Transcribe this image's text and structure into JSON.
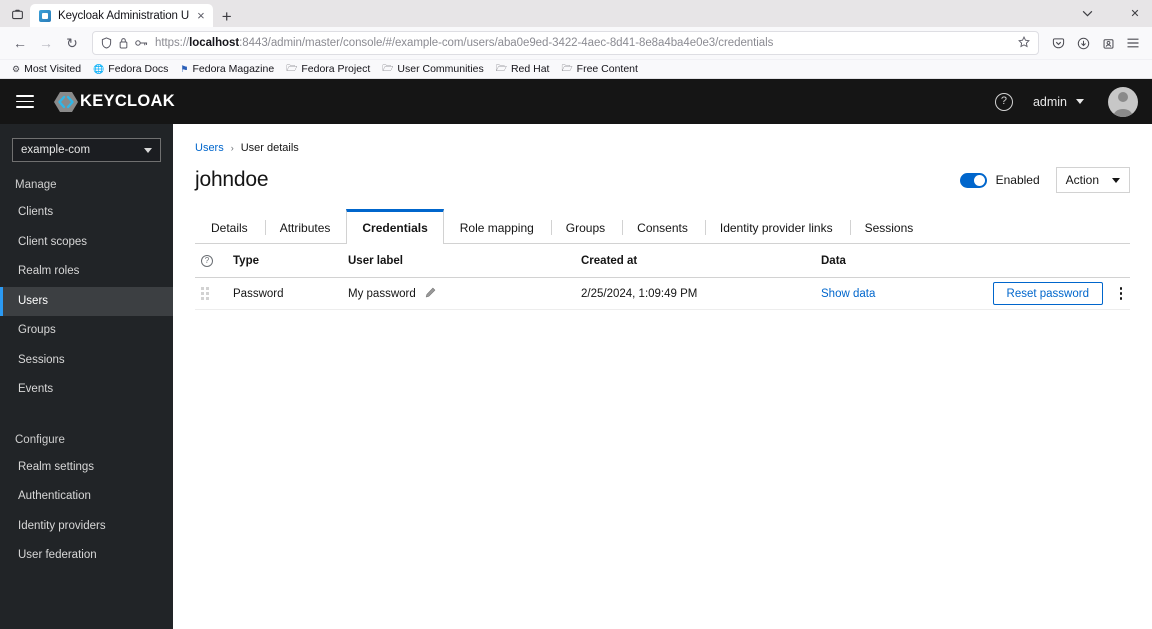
{
  "browser": {
    "tab": {
      "title": "Keycloak Administration U",
      "favicon": "keycloak-favicon",
      "close": "×"
    },
    "new_tab": "+",
    "tab_list": "⌄",
    "window": {
      "minimize": "⌄",
      "close": "✕"
    },
    "nav": {
      "back": "←",
      "forward": "→",
      "reload": "↻"
    },
    "url": {
      "prefix": "https://",
      "host": "localhost",
      "rest": ":8443/admin/master/console/#/example-com/users/aba0e9ed-3422-4aec-8d41-8e8a4ba4e0e3/credentials",
      "shield_icon": "shield-icon",
      "lock_icon": "lock-icon",
      "key_icon": "key-icon",
      "star_icon": "star-icon"
    },
    "toolbar_icons": [
      "pocket-icon",
      "downloads-icon",
      "account-icon",
      "app-menu-icon"
    ],
    "bookmarks": [
      {
        "label": "Most Visited",
        "icon": "gear-icon"
      },
      {
        "label": "Fedora Docs",
        "icon": "globe-icon"
      },
      {
        "label": "Fedora Magazine",
        "icon": "flag-icon"
      },
      {
        "label": "Fedora Project",
        "icon": "folder-icon"
      },
      {
        "label": "User Communities",
        "icon": "folder-icon"
      },
      {
        "label": "Red Hat",
        "icon": "folder-icon"
      },
      {
        "label": "Free Content",
        "icon": "folder-icon"
      }
    ]
  },
  "masthead": {
    "menu_icon": "hamburger-icon",
    "brand": "KEYCLOAK",
    "help_icon": "question-circle-icon",
    "user": "admin",
    "avatar": "user-avatar"
  },
  "sidebar": {
    "realm": "example-com",
    "groups": [
      {
        "label": "Manage",
        "items": [
          {
            "label": "Clients",
            "active": false
          },
          {
            "label": "Client scopes",
            "active": false
          },
          {
            "label": "Realm roles",
            "active": false
          },
          {
            "label": "Users",
            "active": true
          },
          {
            "label": "Groups",
            "active": false
          },
          {
            "label": "Sessions",
            "active": false
          },
          {
            "label": "Events",
            "active": false
          }
        ]
      },
      {
        "label": "Configure",
        "items": [
          {
            "label": "Realm settings",
            "active": false
          },
          {
            "label": "Authentication",
            "active": false
          },
          {
            "label": "Identity providers",
            "active": false
          },
          {
            "label": "User federation",
            "active": false
          }
        ]
      }
    ]
  },
  "page": {
    "breadcrumb": {
      "parent": "Users",
      "separator": "›",
      "current": "User details"
    },
    "title": "johndoe",
    "enabled_label": "Enabled",
    "enabled_state": true,
    "action_label": "Action",
    "tabs": [
      {
        "label": "Details",
        "active": false
      },
      {
        "label": "Attributes",
        "active": false
      },
      {
        "label": "Credentials",
        "active": true
      },
      {
        "label": "Role mapping",
        "active": false
      },
      {
        "label": "Groups",
        "active": false
      },
      {
        "label": "Consents",
        "active": false
      },
      {
        "label": "Identity provider links",
        "active": false
      },
      {
        "label": "Sessions",
        "active": false
      }
    ]
  },
  "table": {
    "headers": {
      "info_icon": "help-circle-icon",
      "type": "Type",
      "user_label": "User label",
      "created_at": "Created at",
      "data": "Data"
    },
    "rows": [
      {
        "grip": "drag-handle-icon",
        "type": "Password",
        "user_label": "My password",
        "edit_icon": "pencil-icon",
        "created_at": "2/25/2024, 1:09:49 PM",
        "data_link": "Show data",
        "reset_button": "Reset password",
        "kebab": "kebab-menu-icon"
      }
    ]
  },
  "colors": {
    "accent_blue": "#0066cc",
    "nav_accent": "#2b9af3",
    "masthead_bg": "#151515",
    "sidebar_bg": "#212427"
  }
}
